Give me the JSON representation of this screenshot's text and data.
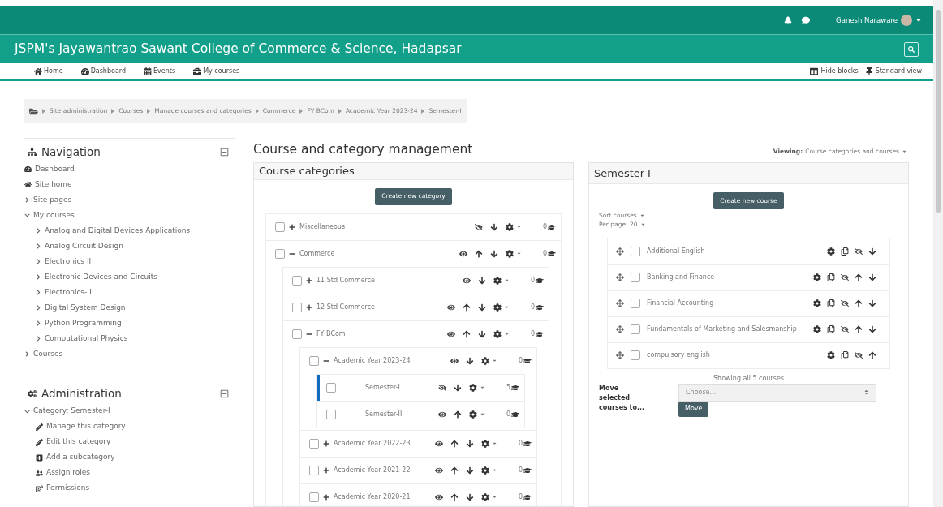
{
  "topbar": {
    "user_name": "Ganesh Naraware"
  },
  "header": {
    "title": "JSPM's Jayawantrao Sawant College of Commerce & Science, Hadapsar"
  },
  "nav_links": [
    "Home",
    "Dashboard",
    "Events",
    "My courses"
  ],
  "page_actions": [
    "Hide blocks",
    "Standard view"
  ],
  "breadcrumb": [
    "Site administration",
    "Courses",
    "Manage courses and categories",
    "Commerce",
    "FY BCom",
    "Academic Year 2023-24",
    "Semester-I"
  ],
  "navigation_block": {
    "title": "Navigation",
    "items": [
      {
        "label": "Dashboard"
      },
      {
        "label": "Site home"
      },
      {
        "label": "Site pages",
        "expanded": false
      },
      {
        "label": "My courses",
        "expanded": true,
        "children": [
          {
            "label": "Analog and Digital Devices Applications",
            "expanded": false
          },
          {
            "label": "Analog Circuit Design",
            "expanded": false
          },
          {
            "label": "Electronics II",
            "expanded": false
          },
          {
            "label": "Electronic Devices and Circuits",
            "expanded": false
          },
          {
            "label": "Electronics- I",
            "expanded": false
          },
          {
            "label": "Digital System Design",
            "expanded": false
          },
          {
            "label": "Python Programming",
            "expanded": false
          },
          {
            "label": "Computational Physics",
            "expanded": false
          }
        ]
      },
      {
        "label": "Courses",
        "expanded": false
      }
    ]
  },
  "administration_block": {
    "title": "Administration",
    "items": [
      {
        "label": "Category: Semester-I",
        "expanded": true,
        "children": [
          {
            "label": "Manage this category"
          },
          {
            "label": "Edit this category"
          },
          {
            "label": "Add a subcategory"
          },
          {
            "label": "Assign roles"
          },
          {
            "label": "Permissions"
          }
        ]
      }
    ]
  },
  "page_title": "Course and category management",
  "viewing": {
    "label": "Viewing:",
    "value": "Course categories and courses"
  },
  "categories_panel": {
    "title": "Course categories",
    "button": "Create new category",
    "categories": [
      {
        "name": "Miscellaneous",
        "expanded": false,
        "checked": false,
        "selected": false,
        "hidden": true,
        "can_move_up": false,
        "can_move_down": true,
        "count": "0"
      },
      {
        "name": "Commerce",
        "expanded": true,
        "checked": false,
        "selected": false,
        "hidden": false,
        "can_move_up": true,
        "can_move_down": true,
        "count": "0",
        "children": [
          {
            "name": "11 Std Commerce",
            "expanded": false,
            "checked": false,
            "selected": false,
            "hidden": false,
            "can_move_up": false,
            "can_move_down": true,
            "count": "0"
          },
          {
            "name": "12 Std Commerce",
            "expanded": false,
            "checked": false,
            "selected": false,
            "hidden": false,
            "can_move_up": true,
            "can_move_down": true,
            "count": "0"
          },
          {
            "name": "FY BCom",
            "expanded": true,
            "checked": false,
            "selected": false,
            "hidden": false,
            "can_move_up": true,
            "can_move_down": true,
            "count": "0",
            "children": [
              {
                "name": "Academic Year 2023-24",
                "expanded": true,
                "checked": false,
                "selected": false,
                "hidden": false,
                "can_move_up": false,
                "can_move_down": true,
                "count": "0",
                "children": [
                  {
                    "name": "Semester-I",
                    "checked": false,
                    "selected": true,
                    "hidden": true,
                    "can_move_up": false,
                    "can_move_down": true,
                    "count": "5"
                  },
                  {
                    "name": "Semester-II",
                    "checked": false,
                    "selected": false,
                    "hidden": false,
                    "can_move_up": true,
                    "can_move_down": false,
                    "count": "0"
                  }
                ]
              },
              {
                "name": "Academic Year 2022-23",
                "expanded": false,
                "checked": false,
                "selected": false,
                "hidden": false,
                "can_move_up": true,
                "can_move_down": true,
                "count": "0"
              },
              {
                "name": "Academic Year 2021-22",
                "expanded": false,
                "checked": false,
                "selected": false,
                "hidden": false,
                "can_move_up": true,
                "can_move_down": true,
                "count": "0"
              },
              {
                "name": "Academic Year 2020-21",
                "expanded": false,
                "checked": false,
                "selected": false,
                "hidden": false,
                "can_move_up": true,
                "can_move_down": true,
                "count": "0"
              }
            ]
          }
        ]
      }
    ]
  },
  "courses_panel": {
    "title": "Semester-I",
    "button": "Create new course",
    "sort": "Sort courses",
    "per_page": "Per page: 20",
    "courses": [
      {
        "name": "Additional English",
        "checked": false,
        "hidden": true,
        "can_move_up": false,
        "can_move_down": true
      },
      {
        "name": "Banking and Finance",
        "checked": false,
        "hidden": true,
        "can_move_up": true,
        "can_move_down": true
      },
      {
        "name": "Financial Accounting",
        "checked": false,
        "hidden": true,
        "can_move_up": true,
        "can_move_down": true
      },
      {
        "name": "Fundamentals of Marketing and Salesmanship",
        "checked": false,
        "hidden": true,
        "can_move_up": true,
        "can_move_down": true
      },
      {
        "name": "compulsory english",
        "checked": false,
        "hidden": true,
        "can_move_up": true,
        "can_move_down": false
      }
    ],
    "summary": "Showing all 5 courses",
    "move_label": "Move selected courses to...",
    "move_select": {
      "placeholder": "Choose..."
    },
    "move_button": "Move"
  }
}
